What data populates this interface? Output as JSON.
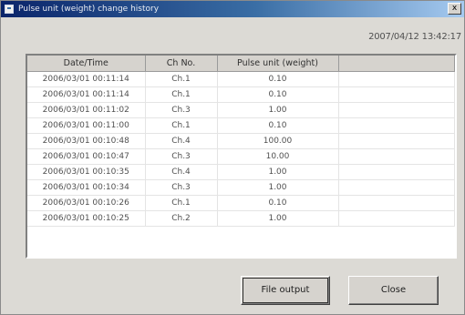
{
  "window": {
    "title": "Pulse unit (weight) change history",
    "close_label": "x"
  },
  "timestamp": "2007/04/12 13:42:17",
  "table": {
    "columns": [
      "Date/Time",
      "Ch No.",
      "Pulse unit (weight)",
      ""
    ],
    "rows": [
      [
        "2006/03/01 00:11:14",
        "Ch.1",
        "0.10",
        ""
      ],
      [
        "2006/03/01 00:11:14",
        "Ch.1",
        "0.10",
        ""
      ],
      [
        "2006/03/01 00:11:02",
        "Ch.3",
        "1.00",
        ""
      ],
      [
        "2006/03/01 00:11:00",
        "Ch.1",
        "0.10",
        ""
      ],
      [
        "2006/03/01 00:10:48",
        "Ch.4",
        "100.00",
        ""
      ],
      [
        "2006/03/01 00:10:47",
        "Ch.3",
        "10.00",
        ""
      ],
      [
        "2006/03/01 00:10:35",
        "Ch.4",
        "1.00",
        ""
      ],
      [
        "2006/03/01 00:10:34",
        "Ch.3",
        "1.00",
        ""
      ],
      [
        "2006/03/01 00:10:26",
        "Ch.1",
        "0.10",
        ""
      ],
      [
        "2006/03/01 00:10:25",
        "Ch.2",
        "1.00",
        ""
      ]
    ]
  },
  "buttons": {
    "file_output": "File output",
    "close": "Close"
  }
}
